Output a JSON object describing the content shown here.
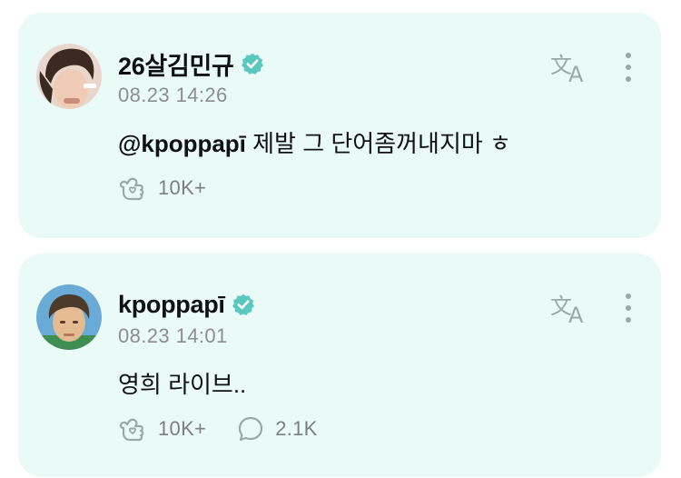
{
  "posts": [
    {
      "author": "26살김민규",
      "timestamp": "08.23 14:26",
      "mention": "@kpoppapī",
      "text": "제발 그 단어좀꺼내지마 ㅎ",
      "reactions": {
        "like_count": "10K+",
        "comment_count": null
      },
      "avatar_colors": {
        "bg": "#e9d7cd",
        "hair": "#3a2a22",
        "skin": "#f0cbb5"
      }
    },
    {
      "author": "kpoppapī",
      "timestamp": "08.23 14:01",
      "mention": "",
      "text": "영희 라이브..",
      "reactions": {
        "like_count": "10K+",
        "comment_count": "2.1K"
      },
      "avatar_colors": {
        "bg": "#6aaad6",
        "hair": "#4c3a2a",
        "skin": "#e4bb92"
      }
    }
  ],
  "icons": {
    "verified": "verified-badge-icon",
    "translate": "translate-icon",
    "more": "more-vertical-icon",
    "like": "heart-hand-icon",
    "comment": "comment-bubble-icon"
  },
  "colors": {
    "card_bg": "#e9faf7",
    "verified": "#5bc8c0",
    "icon": "#9aa9a6",
    "secondary_text": "#8d8d8d"
  }
}
